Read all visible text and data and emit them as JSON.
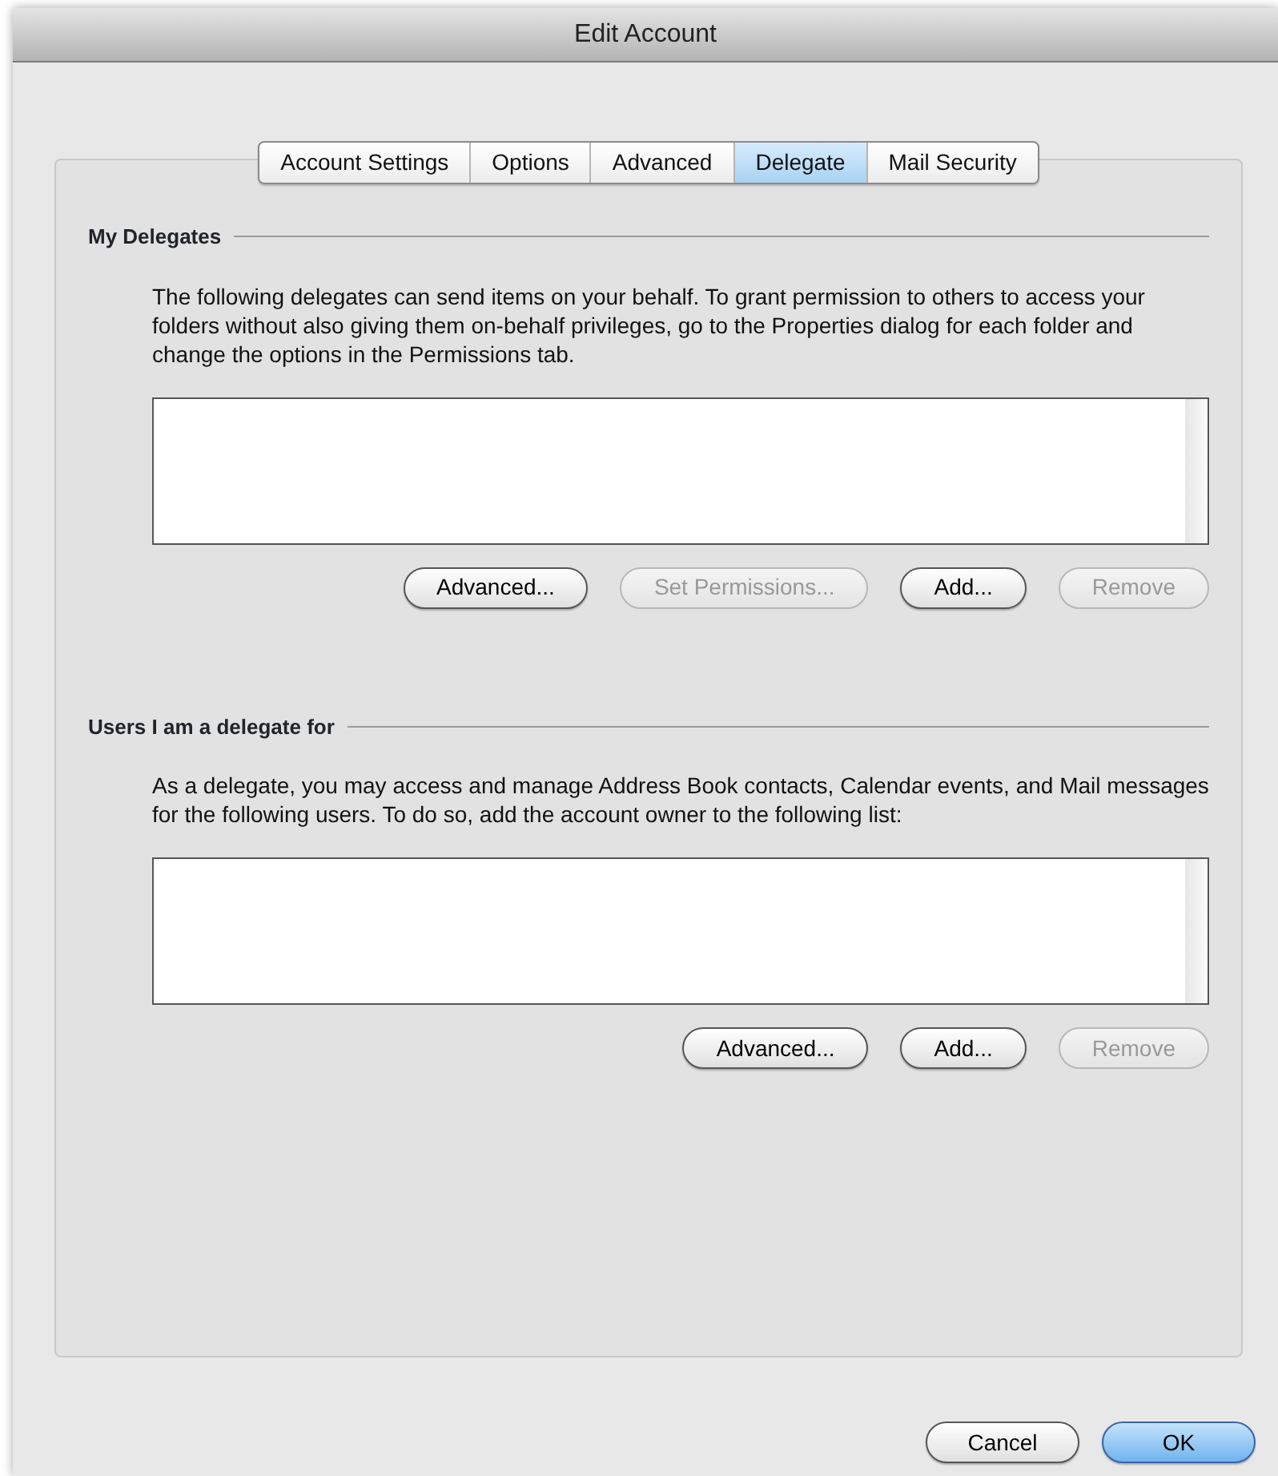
{
  "window": {
    "title": "Edit Account"
  },
  "tabs": [
    {
      "label": "Account Settings",
      "selected": false
    },
    {
      "label": "Options",
      "selected": false
    },
    {
      "label": "Advanced",
      "selected": false
    },
    {
      "label": "Delegate",
      "selected": true
    },
    {
      "label": "Mail Security",
      "selected": false
    }
  ],
  "sections": [
    {
      "heading": "My Delegates",
      "text": "The following delegates can send items on your behalf. To grant permission to others to access your folders without also giving them on-behalf privileges, go to the Properties dialog for each folder and change the options in the Permissions tab.",
      "buttons": [
        {
          "label": "Advanced...",
          "disabled": false
        },
        {
          "label": "Set Permissions...",
          "disabled": true
        },
        {
          "label": "Add...",
          "disabled": false
        },
        {
          "label": "Remove",
          "disabled": true
        }
      ]
    },
    {
      "heading": "Users I am a delegate for",
      "text": "As a delegate, you may access and manage Address Book contacts, Calendar events, and Mail messages for the following users. To do so, add the account owner to the following list:",
      "buttons": [
        {
          "label": "Advanced...",
          "disabled": false
        },
        {
          "label": "Add...",
          "disabled": false
        },
        {
          "label": "Remove",
          "disabled": true
        }
      ]
    }
  ],
  "footer_buttons": [
    {
      "label": "Cancel",
      "kind": "normal"
    },
    {
      "label": "OK",
      "kind": "default"
    }
  ]
}
